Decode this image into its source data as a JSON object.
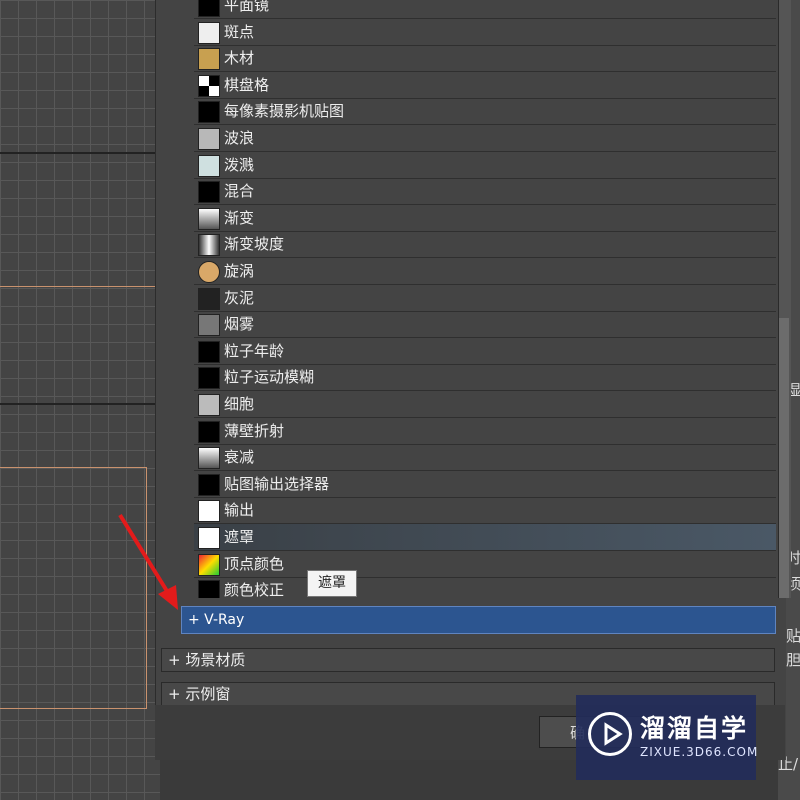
{
  "map_list": {
    "items": [
      {
        "label": "平面镜",
        "swatch": "#000000",
        "selected": false
      },
      {
        "label": "斑点",
        "swatch": "#eeeeee",
        "selected": false
      },
      {
        "label": "木材",
        "swatch": "#c8a050",
        "selected": false
      },
      {
        "label": "棋盘格",
        "swatch": "checker",
        "selected": false
      },
      {
        "label": "每像素摄影机贴图",
        "swatch": "#000000",
        "selected": false
      },
      {
        "label": "波浪",
        "swatch": "#b8b8b8",
        "selected": false
      },
      {
        "label": "泼溅",
        "swatch": "#cfe0e0",
        "selected": false
      },
      {
        "label": "混合",
        "swatch": "#000000",
        "selected": false
      },
      {
        "label": "渐变",
        "swatch": "gradient",
        "selected": false
      },
      {
        "label": "渐变坡度",
        "swatch": "gradient-h",
        "selected": false
      },
      {
        "label": "旋涡",
        "swatch": "#d9a868",
        "selected": false
      },
      {
        "label": "灰泥",
        "swatch": "#222222",
        "selected": false
      },
      {
        "label": "烟雾",
        "swatch": "#777777",
        "selected": false
      },
      {
        "label": "粒子年龄",
        "swatch": "#000000",
        "selected": false
      },
      {
        "label": "粒子运动模糊",
        "swatch": "#000000",
        "selected": false
      },
      {
        "label": "细胞",
        "swatch": "#bbbbbb",
        "selected": false
      },
      {
        "label": "薄壁折射",
        "swatch": "#000000",
        "selected": false
      },
      {
        "label": "衰减",
        "swatch": "gradient",
        "selected": false
      },
      {
        "label": "贴图输出选择器",
        "swatch": "#000000",
        "selected": false
      },
      {
        "label": "输出",
        "swatch": "#ffffff",
        "selected": false
      },
      {
        "label": "遮罩",
        "swatch": "#ffffff",
        "selected": true
      },
      {
        "label": "顶点颜色",
        "swatch": "vertex",
        "selected": false
      },
      {
        "label": "颜色校正",
        "swatch": "#000000",
        "selected": false
      }
    ]
  },
  "tooltip": {
    "text": "遮罩"
  },
  "vray_group": {
    "label": "+ V-Ray"
  },
  "rollouts": [
    {
      "label": "+ 场景材质"
    },
    {
      "label": "+ 示例窗"
    }
  ],
  "ok_button": {
    "label": "确"
  },
  "side_text": [
    "湿",
    "时",
    "顷",
    "贴",
    "胆",
    "止/"
  ],
  "watermark": {
    "title": "溜溜自学",
    "url": "ZIXUE.3D66.COM"
  }
}
